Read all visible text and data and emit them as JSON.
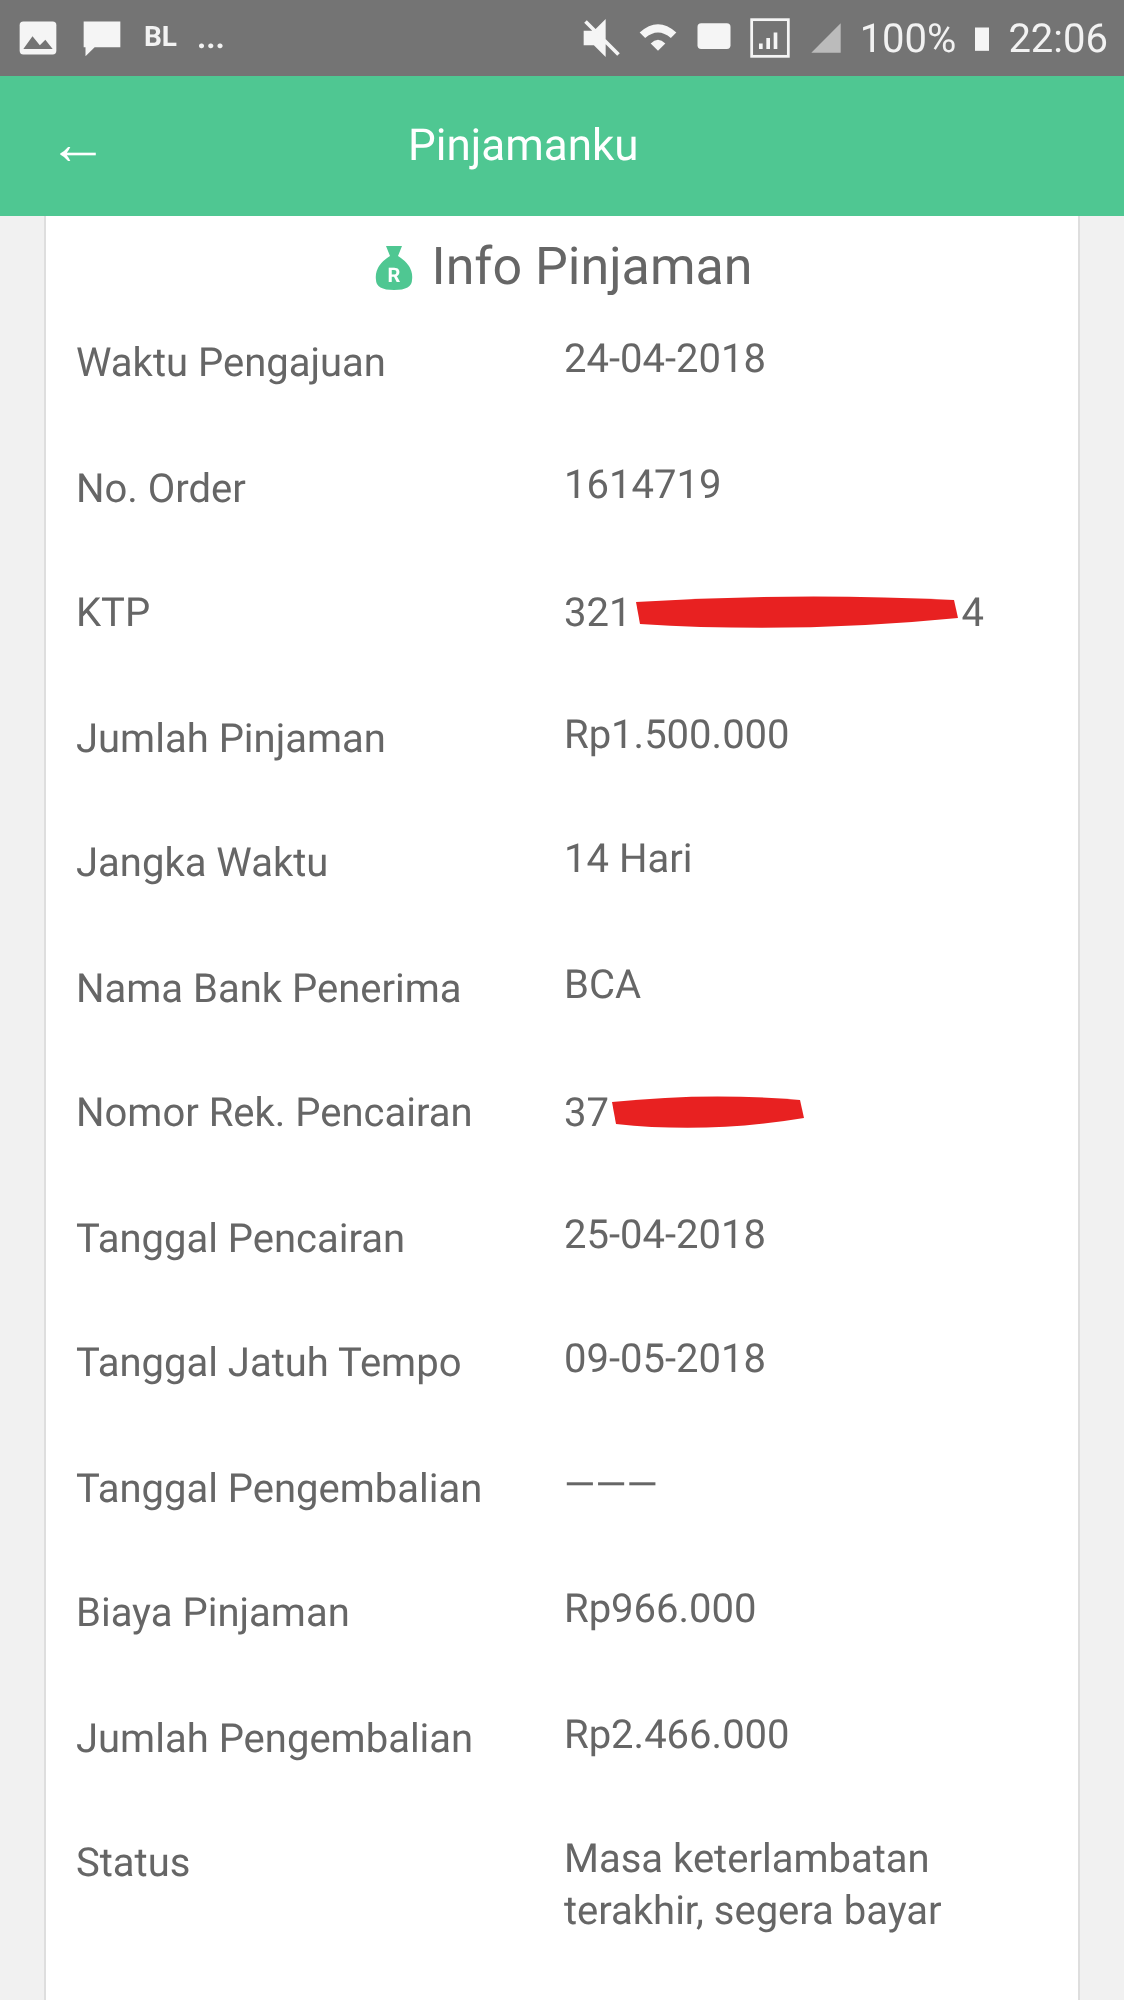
{
  "status_bar": {
    "left_text": "BL",
    "more": "...",
    "battery": "100%",
    "time": "22:06"
  },
  "header": {
    "back": "←",
    "title": "Pinjamanku"
  },
  "card": {
    "icon_letter": "R",
    "title": "Info Pinjaman",
    "rows": [
      {
        "kind": "text",
        "label": "Waktu Pengajuan",
        "value": "24-04-2018"
      },
      {
        "kind": "text",
        "label": "No. Order",
        "value": "1614719"
      },
      {
        "kind": "redacted",
        "label": "KTP",
        "prefix": "321",
        "suffix": "4"
      },
      {
        "kind": "text",
        "label": "Jumlah Pinjaman",
        "value": "Rp1.500.000"
      },
      {
        "kind": "text",
        "label": "Jangka Waktu",
        "value": "14 Hari"
      },
      {
        "kind": "text",
        "label": "Nama Bank Penerima",
        "value": "BCA"
      },
      {
        "kind": "redacted",
        "label": "Nomor Rek. Pencairan",
        "prefix": "37"
      },
      {
        "kind": "text",
        "label": "Tanggal Pencairan",
        "value": "25-04-2018"
      },
      {
        "kind": "text",
        "label": "Tanggal Jatuh Tempo",
        "value": "09-05-2018"
      },
      {
        "kind": "text",
        "label": "Tanggal Pengembalian",
        "value": "———"
      },
      {
        "kind": "text",
        "label": "Biaya Pinjaman",
        "value": "Rp966.000"
      },
      {
        "kind": "text",
        "label": "Jumlah Pengembalian",
        "value": "Rp2.466.000"
      },
      {
        "kind": "text",
        "label": "Status",
        "value": "Masa keterlambatan terakhir, segera bayar"
      }
    ]
  }
}
